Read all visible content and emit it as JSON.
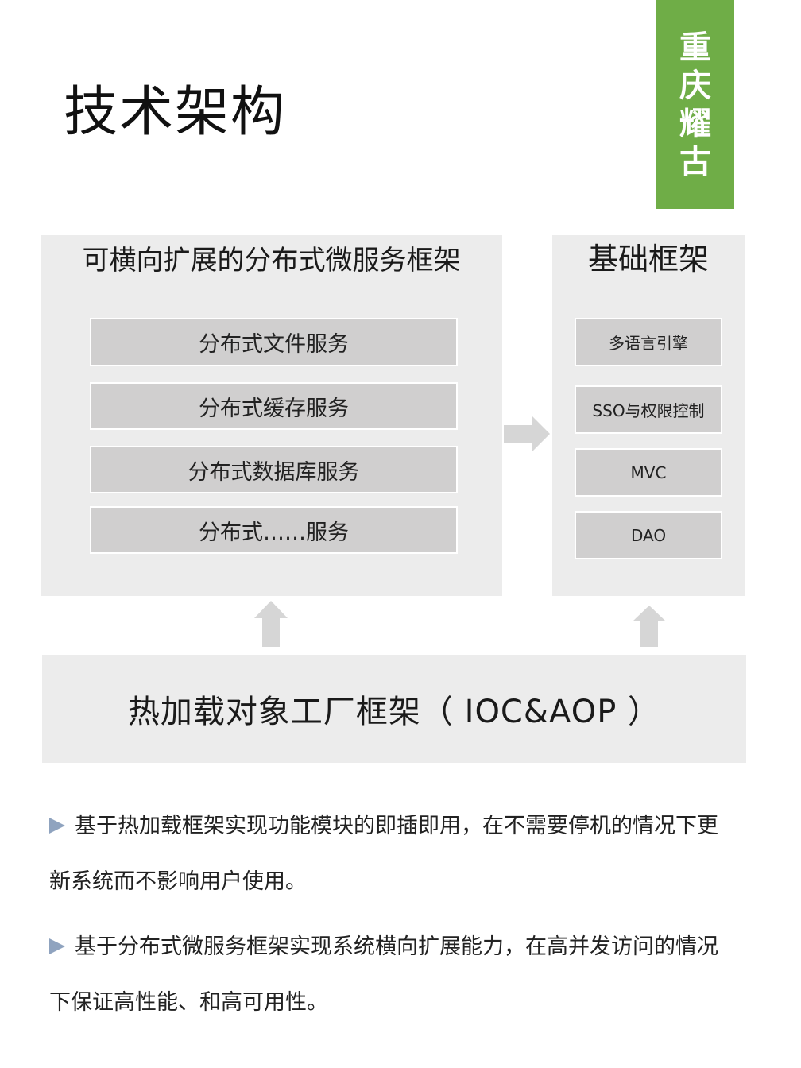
{
  "title": "技术架构",
  "brand": {
    "chars": [
      "重",
      "庆",
      "耀",
      "古"
    ],
    "color": "#6fad47"
  },
  "left_panel": {
    "title": "可横向扩展的分布式微服务框架",
    "items": [
      "分布式文件服务",
      "分布式缓存服务",
      "分布式数据库服务",
      "分布式……服务"
    ]
  },
  "right_panel": {
    "title": "基础框架",
    "items": [
      "多语言引擎",
      "SSO与权限控制",
      "MVC",
      "DAO"
    ]
  },
  "bottom_panel": {
    "title": "热加载对象工厂框架（ IOC&AOP ）"
  },
  "bullets": [
    "基于热加载框架实现功能模块的即插即用，在不需要停机的情况下更新系统而不影响用户使用。",
    "基于分布式微服务框架实现系统横向扩展能力，在高并发访问的情况下保证高性能、和高可用性。"
  ],
  "colors": {
    "panel_bg": "#ececec",
    "box_bg": "#d0cfcf",
    "arrow": "#d6d6d6",
    "bullet": "#8fa3bf"
  }
}
